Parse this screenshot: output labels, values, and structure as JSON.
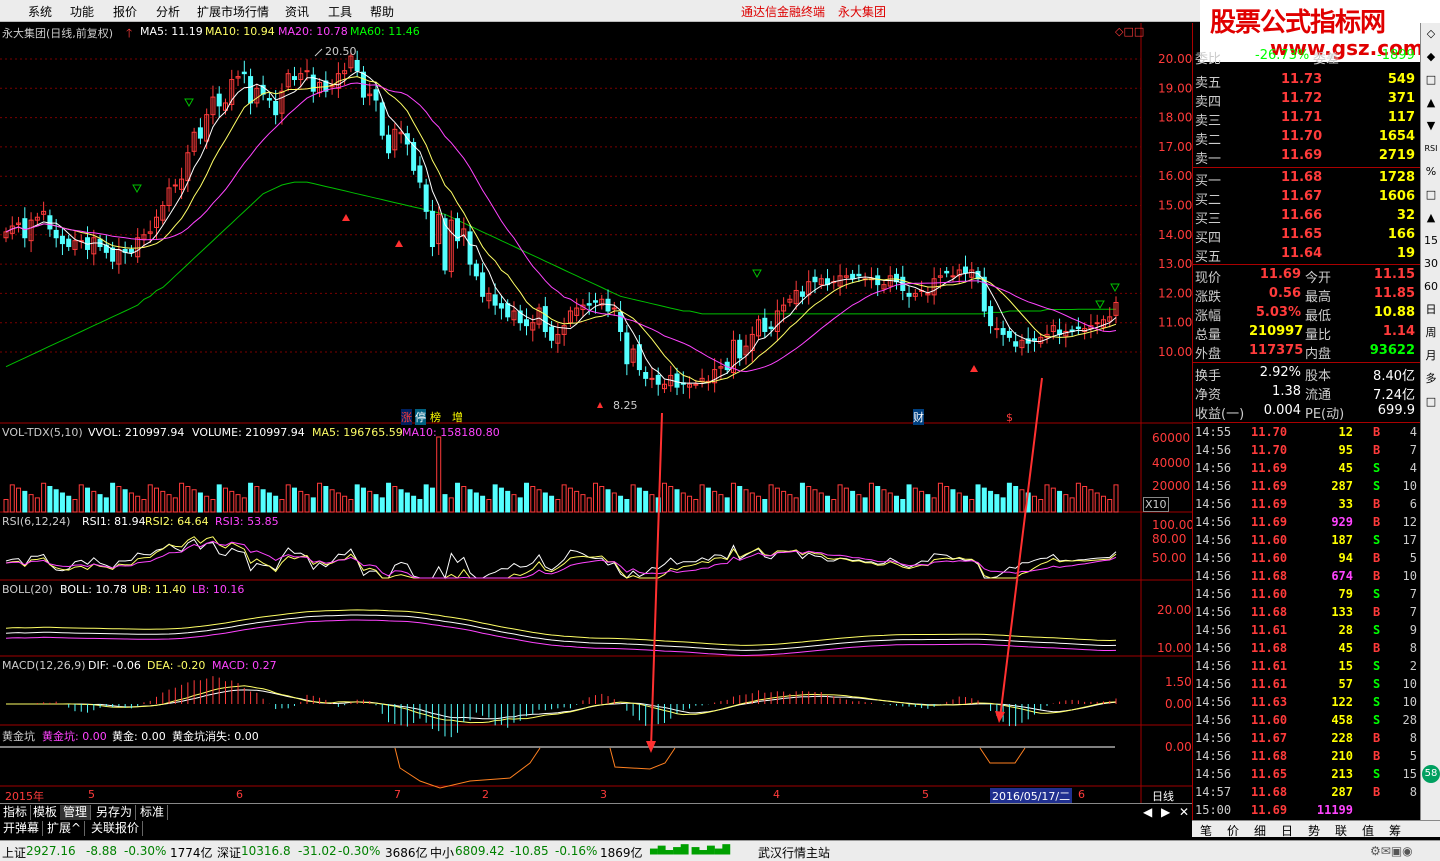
{
  "menu": {
    "items": [
      "系统",
      "功能",
      "报价",
      "分析",
      "扩展市场行情",
      "资讯",
      "工具",
      "帮助"
    ],
    "center_title": "通达信金融终端",
    "center_company": "永大集团"
  },
  "logo": {
    "title": "股票公式指标网",
    "url": "www.gsz.com.cn"
  },
  "chart": {
    "header": {
      "stock": "永大集团(日线,前复权)",
      "ma5": "MA5: 11.19",
      "ma10": "MA10: 10.94",
      "ma20": "MA20: 10.78",
      "ma60": "MA60: 11.46"
    },
    "price_axis": [
      "20.00",
      "19.00",
      "18.00",
      "17.00",
      "16.00",
      "15.00",
      "14.00",
      "13.00",
      "12.00",
      "11.00",
      "10.00"
    ],
    "high_label": "20.50",
    "low_label": "8.25",
    "event_labels": {
      "a": "涨",
      "b": "停",
      "c": "榜",
      "d": "增",
      "e": "财",
      "f": "$"
    },
    "vol_header": {
      "name": "VOL-TDX(5,10)",
      "vvol": "VVOL: 210997.94",
      "volume": "VOLUME: 210997.94",
      "ma5": "MA5: 196765.59",
      "ma10": "MA10: 158180.80"
    },
    "vol_axis": [
      "60000",
      "40000",
      "20000"
    ],
    "vol_unit": "X10",
    "rsi_header": {
      "name": "RSI(6,12,24)",
      "r1": "RSI1: 81.94",
      "r2": "RSI2: 64.64",
      "r3": "RSI3: 53.85"
    },
    "rsi_axis": [
      "100.00",
      "80.00",
      "50.00"
    ],
    "boll_header": {
      "name": "BOLL(20)",
      "boll": "BOLL: 10.78",
      "ub": "UB: 11.40",
      "lb": "LB: 10.16"
    },
    "boll_axis": [
      "20.00",
      "10.00"
    ],
    "macd_header": {
      "name": "MACD(12,26,9)",
      "dif": "DIF: -0.06",
      "dea": "DEA: -0.20",
      "macd": "MACD: 0.27"
    },
    "macd_axis": [
      "1.50",
      "0.00"
    ],
    "gold_header": {
      "name": "黄金坑",
      "keng": "黄金坑: 0.00",
      "gold": "黄金: 0.00",
      "gone": "黄金坑消失: 0.00"
    },
    "gold_axis": [
      "0.00"
    ],
    "date_axis": [
      {
        "t": "2015年",
        "x": 5
      },
      {
        "t": "5",
        "x": 88
      },
      {
        "t": "6",
        "x": 236
      },
      {
        "t": "7",
        "x": 394
      },
      {
        "t": "2",
        "x": 482
      },
      {
        "t": "3",
        "x": 600
      },
      {
        "t": "4",
        "x": 773
      },
      {
        "t": "5",
        "x": 922
      },
      {
        "t": "6",
        "x": 1078
      }
    ],
    "date_cursor": "2016/05/17/二",
    "period": "日线"
  },
  "quote": {
    "wb_label": "委比",
    "wb_val": "-26.73%",
    "wc_label": "委差",
    "wc_val": "-1899",
    "asks": [
      {
        "label": "卖五",
        "price": "11.73",
        "vol": "549"
      },
      {
        "label": "卖四",
        "price": "11.72",
        "vol": "371"
      },
      {
        "label": "卖三",
        "price": "11.71",
        "vol": "117"
      },
      {
        "label": "卖二",
        "price": "11.70",
        "vol": "1654"
      },
      {
        "label": "卖一",
        "price": "11.69",
        "vol": "2719"
      }
    ],
    "bids": [
      {
        "label": "买一",
        "price": "11.68",
        "vol": "1728"
      },
      {
        "label": "买二",
        "price": "11.67",
        "vol": "1606"
      },
      {
        "label": "买三",
        "price": "11.66",
        "vol": "32"
      },
      {
        "label": "买四",
        "price": "11.65",
        "vol": "166"
      },
      {
        "label": "买五",
        "price": "11.64",
        "vol": "19"
      }
    ],
    "stats": [
      {
        "l1": "现价",
        "v1": "11.69",
        "l2": "今开",
        "v2": "11.15",
        "c1": "#ff3b3b",
        "c2": "#ff3b3b"
      },
      {
        "l1": "涨跌",
        "v1": "0.56",
        "l2": "最高",
        "v2": "11.85",
        "c1": "#ff3b3b",
        "c2": "#ff3b3b"
      },
      {
        "l1": "涨幅",
        "v1": "5.03%",
        "l2": "最低",
        "v2": "10.88",
        "c1": "#ff3b3b",
        "c2": "#ffff00"
      },
      {
        "l1": "总量",
        "v1": "210997",
        "l2": "量比",
        "v2": "1.14",
        "c1": "#ffff00",
        "c2": "#ff3b3b"
      },
      {
        "l1": "外盘",
        "v1": "117375",
        "l2": "内盘",
        "v2": "93622",
        "c1": "#ff3b3b",
        "c2": "#00ff00"
      }
    ],
    "stats2": [
      {
        "l1": "换手",
        "v1": "2.92%",
        "l2": "股本",
        "v2": "8.40亿"
      },
      {
        "l1": "净资",
        "v1": "1.38",
        "l2": "流通",
        "v2": "7.24亿"
      },
      {
        "l1": "收益(一)",
        "v1": "0.004",
        "l2": "PE(动)",
        "v2": "699.9"
      }
    ],
    "ticks": [
      [
        "14:55",
        "11.70",
        "12",
        "B",
        "4"
      ],
      [
        "14:56",
        "11.70",
        "95",
        "B",
        "7"
      ],
      [
        "14:56",
        "11.69",
        "45",
        "S",
        "4"
      ],
      [
        "14:56",
        "11.69",
        "287",
        "S",
        "10"
      ],
      [
        "14:56",
        "11.69",
        "33",
        "B",
        "6"
      ],
      [
        "14:56",
        "11.69",
        "929",
        "B",
        "12"
      ],
      [
        "14:56",
        "11.60",
        "187",
        "S",
        "17"
      ],
      [
        "14:56",
        "11.60",
        "94",
        "B",
        "5"
      ],
      [
        "14:56",
        "11.68",
        "674",
        "B",
        "10"
      ],
      [
        "14:56",
        "11.60",
        "79",
        "S",
        "7"
      ],
      [
        "14:56",
        "11.68",
        "133",
        "B",
        "7"
      ],
      [
        "14:56",
        "11.61",
        "28",
        "S",
        "9"
      ],
      [
        "14:56",
        "11.68",
        "45",
        "B",
        "8"
      ],
      [
        "14:56",
        "11.61",
        "15",
        "S",
        "2"
      ],
      [
        "14:56",
        "11.61",
        "57",
        "S",
        "10"
      ],
      [
        "14:56",
        "11.63",
        "122",
        "S",
        "10"
      ],
      [
        "14:56",
        "11.60",
        "458",
        "S",
        "28"
      ],
      [
        "14:56",
        "11.67",
        "228",
        "B",
        "8"
      ],
      [
        "14:56",
        "11.68",
        "210",
        "B",
        "5"
      ],
      [
        "14:56",
        "11.65",
        "213",
        "S",
        "15"
      ],
      [
        "14:57",
        "11.68",
        "287",
        "B",
        "8"
      ],
      [
        "15:00",
        "11.69",
        "11199",
        "",
        ""
      ]
    ]
  },
  "side_tabs": [
    "◇",
    "◆",
    "□",
    "▲",
    "▼",
    "RSI",
    "%",
    "□",
    "▲",
    "15",
    "30",
    "60",
    "日",
    "周",
    "月",
    "多",
    "□"
  ],
  "side_badge": "58",
  "bottom_tabs1": [
    "指标",
    "模板",
    "管理",
    "另存为",
    "标准"
  ],
  "bottom_tabs2": [
    "开弹幕",
    "扩展^",
    "关联报价"
  ],
  "quote_tabs": [
    "笔",
    "价",
    "细",
    "日",
    "势",
    "联",
    "值",
    "筹"
  ],
  "status": {
    "sh_name": "上证",
    "sh_val": "2927.16",
    "sh_chg": "-8.88",
    "sh_pct": "-0.30%",
    "sh_amt": "1774亿",
    "sz_name": "深证",
    "sz_val": "10316.8",
    "sz_chg": "-31.02",
    "sz_pct": "-0.30%",
    "sz_amt": "3686亿",
    "zx_name": "中小",
    "zx_val": "6809.42",
    "zx_chg": "-10.85",
    "zx_pct": "-0.16%",
    "zx_amt": "1869亿",
    "station": "武汉行情主站"
  },
  "series": {
    "closes": [
      14.1,
      14.3,
      14.4,
      13.9,
      14.5,
      14.6,
      14.8,
      14.2,
      13.9,
      13.7,
      13.6,
      13.8,
      13.8,
      13.5,
      13.9,
      13.6,
      13.4,
      13.1,
      13.5,
      13.4,
      13.4,
      13.9,
      14.0,
      14.1,
      14.6,
      15.0,
      15.6,
      15.7,
      15.9,
      16.8,
      17.5,
      17.3,
      18.1,
      18.7,
      18.4,
      18.5,
      19.3,
      19.4,
      19.5,
      18.5,
      19.0,
      18.8,
      18.6,
      18.1,
      18.9,
      19.5,
      19.3,
      19.5,
      19.6,
      18.9,
      19.2,
      18.9,
      19.1,
      19.5,
      19.6,
      20.1,
      19.6,
      18.7,
      18.8,
      18.6,
      17.4,
      16.8,
      17.6,
      17.5,
      17.1,
      16.2,
      15.8,
      14.8,
      13.6,
      14.7,
      12.8,
      14.5,
      13.8,
      14.2,
      13.0,
      12.6,
      11.9,
      12.0,
      11.6,
      11.5,
      11.2,
      11.4,
      11.0,
      10.9,
      11.0,
      11.5,
      10.7,
      10.4,
      10.6,
      10.9,
      11.4,
      11.5,
      11.6,
      11.6,
      11.7,
      11.8,
      11.4,
      11.5,
      10.7,
      9.6,
      10.1,
      9.4,
      9.1,
      9.1,
      8.9,
      8.9,
      9.2,
      8.8,
      8.9,
      8.9,
      8.9,
      9.1,
      9.0,
      9.4,
      9.5,
      9.4,
      10.4,
      9.8,
      10.2,
      10.6,
      11.1,
      10.7,
      10.8,
      11.4,
      11.6,
      11.8,
      12.1,
      11.9,
      12.4,
      12.4,
      12.5,
      12.3,
      12.4,
      12.6,
      12.6,
      12.5,
      12.6,
      12.5,
      12.5,
      12.3,
      12.3,
      12.6,
      12.4,
      12.1,
      11.9,
      12.0,
      12.1,
      12.0,
      12.5,
      12.6,
      12.7,
      12.6,
      12.8,
      12.7,
      12.8,
      12.5,
      11.4,
      10.9,
      10.8,
      10.6,
      10.5,
      10.2,
      10.4,
      10.3,
      10.4,
      10.5,
      10.6,
      10.9,
      10.6,
      10.7,
      10.7,
      10.8,
      10.8,
      10.9,
      11.0,
      11.1,
      11.2,
      11.69
    ],
    "ma60": [
      9.5,
      9.6,
      9.7,
      9.8,
      9.9,
      10.0,
      10.1,
      10.2,
      10.3,
      10.4,
      10.5,
      10.6,
      10.7,
      10.8,
      10.9,
      11.0,
      11.1,
      11.2,
      11.3,
      11.4,
      11.5,
      11.6,
      11.8,
      11.9,
      12.1,
      12.2,
      12.4,
      12.6,
      12.8,
      13.0,
      13.2,
      13.4,
      13.6,
      13.8,
      14.0,
      14.2,
      14.4,
      14.6,
      14.8,
      15.0,
      15.2,
      15.4,
      15.5,
      15.6,
      15.7,
      15.75,
      15.8,
      15.8,
      15.8,
      15.75,
      15.7,
      15.65,
      15.6,
      15.55,
      15.5,
      15.45,
      15.4,
      15.35,
      15.3,
      15.25,
      15.2,
      15.15,
      15.1,
      15.05,
      15.0,
      14.95,
      14.9,
      14.85,
      14.8,
      14.75,
      14.7,
      14.6,
      14.5,
      14.4,
      14.3,
      14.2,
      14.1,
      14.0,
      13.9,
      13.8,
      13.7,
      13.6,
      13.5,
      13.4,
      13.3,
      13.2,
      13.1,
      13.0,
      12.9,
      12.8,
      12.7,
      12.6,
      12.5,
      12.4,
      12.3,
      12.2,
      12.1,
      12.0,
      11.9,
      11.85,
      11.8,
      11.75,
      11.7,
      11.65,
      11.6,
      11.55,
      11.5,
      11.45,
      11.4,
      11.4,
      11.35,
      11.3,
      11.3,
      11.3,
      11.3,
      11.3,
      11.3,
      11.3,
      11.3,
      11.3,
      11.3,
      11.3,
      11.3,
      11.3,
      11.3,
      11.3,
      11.3,
      11.3,
      11.3,
      11.3,
      11.3,
      11.3,
      11.3,
      11.3,
      11.3,
      11.3,
      11.3,
      11.3,
      11.3,
      11.3,
      11.3,
      11.3,
      11.3,
      11.3,
      11.3,
      11.3,
      11.3,
      11.3,
      11.3,
      11.3,
      11.3,
      11.3,
      11.3,
      11.3,
      11.3,
      11.3,
      11.3,
      11.35,
      11.35,
      11.35,
      11.4,
      11.4,
      11.4,
      11.4,
      11.4,
      11.4,
      11.45,
      11.45,
      11.45,
      11.45,
      11.45,
      11.46,
      11.46,
      11.46,
      11.46,
      11.46,
      11.46,
      11.46
    ]
  }
}
